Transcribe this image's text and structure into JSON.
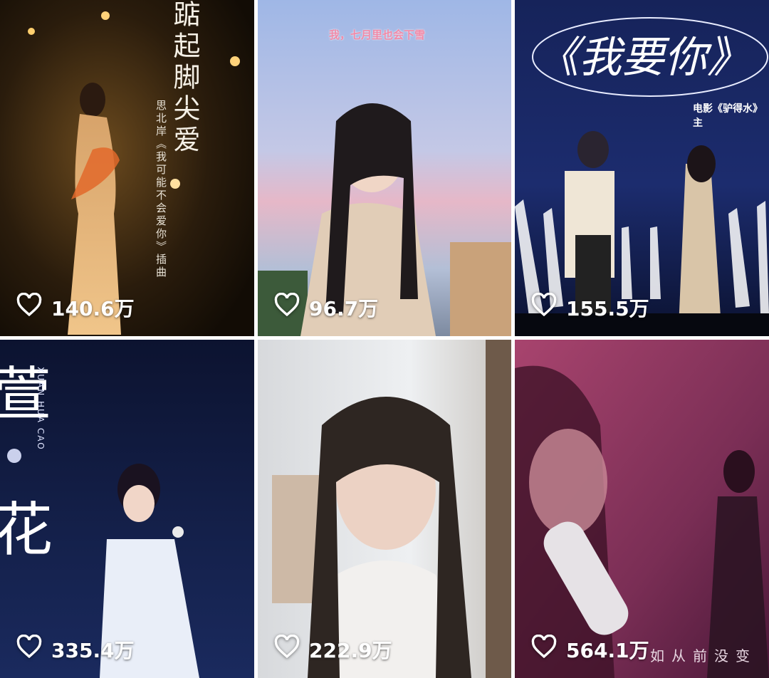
{
  "colors": {
    "like_text": "#ffffff",
    "tile_gap": "#ffffff"
  },
  "videos": [
    {
      "likes": "140.6万",
      "overlay_title": "踮起脚尖爱",
      "overlay_credit": "思北岸《我可能不会爱你》插曲",
      "icon": "heart-outline-icon"
    },
    {
      "likes": "96.7万",
      "overlay_title": "我，七月里也会下雪",
      "icon": "heart-outline-icon"
    },
    {
      "likes": "155.5万",
      "overlay_title": "《我要你》",
      "overlay_subtitle": "电影《驴得水》主",
      "icon": "heart-outline-icon"
    },
    {
      "likes": "335.4万",
      "overlay_title_top": "萱",
      "overlay_title_bottom": "花",
      "overlay_subtitle": "XUAN HUA CAO",
      "icon": "heart-outline-icon"
    },
    {
      "likes": "222.9万",
      "icon": "heart-outline-icon"
    },
    {
      "likes": "564.1万",
      "overlay_caption": "如从前没变",
      "icon": "heart-outline-icon"
    }
  ]
}
